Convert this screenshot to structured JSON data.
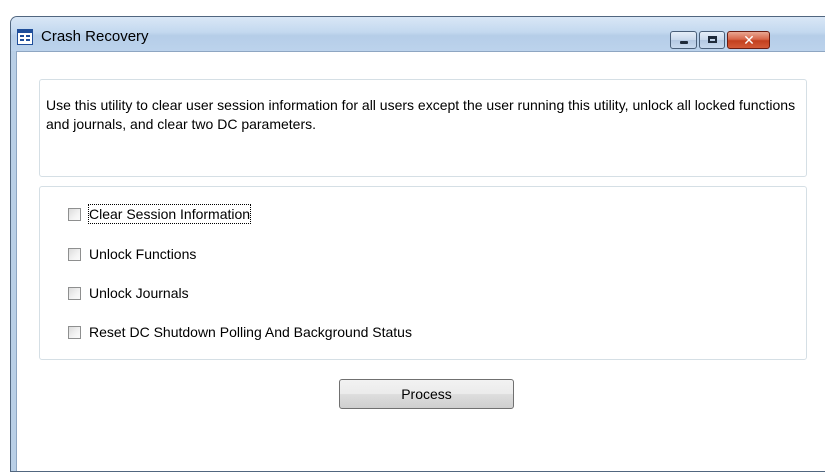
{
  "window": {
    "title": "Crash Recovery",
    "icon": "app-window-icon",
    "controls": {
      "minimize": "minimize-icon",
      "maximize": "maximize-icon",
      "close": "close-icon",
      "close_color": "#c3401f"
    }
  },
  "description": "Use this utility to clear user session information for all users except the user running this utility, unlock all locked functions and journals, and clear two DC parameters.",
  "options": [
    {
      "label": "Clear Session Information",
      "checked": false,
      "focused": true
    },
    {
      "label": "Unlock Functions",
      "checked": false,
      "focused": false
    },
    {
      "label": "Unlock Journals",
      "checked": false,
      "focused": false
    },
    {
      "label": "Reset DC Shutdown Polling And Background Status",
      "checked": false,
      "focused": false
    }
  ],
  "process_button": "Process",
  "colors": {
    "titlebar": "#c3d8ef",
    "frame": "#b9cfe6",
    "group_border": "#d5dfe5"
  }
}
